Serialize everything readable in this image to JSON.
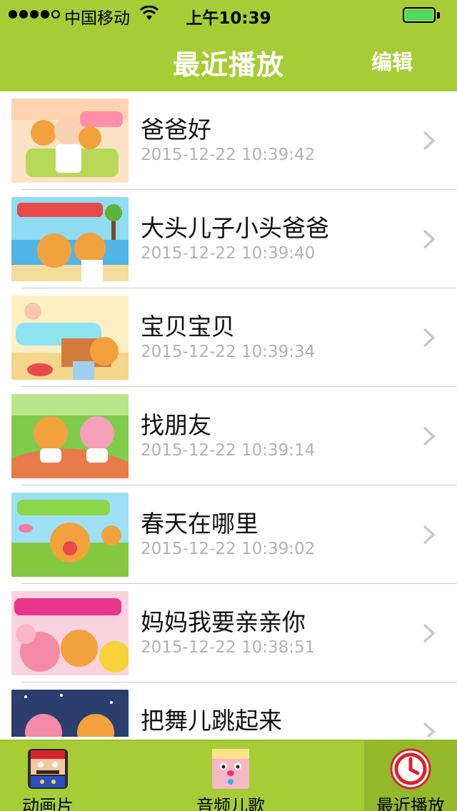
{
  "status_bar": {
    "carrier": "中国移动",
    "time": "上午10:39"
  },
  "nav": {
    "title": "最近播放",
    "edit_label": "编辑"
  },
  "items": [
    {
      "title": "爸爸好",
      "time": "2015-12-22 10:39:42",
      "thumb_label": "爸爸好"
    },
    {
      "title": "大头儿子小头爸爸",
      "time": "2015-12-22 10:39:40",
      "thumb_label": "大头儿子小头爸爸"
    },
    {
      "title": "宝贝宝贝",
      "time": "2015-12-22 10:39:34",
      "thumb_label": "宝贝宝贝"
    },
    {
      "title": "找朋友",
      "time": "2015-12-22 10:39:14",
      "thumb_label": ""
    },
    {
      "title": "春天在哪里",
      "time": "2015-12-22 10:39:02",
      "thumb_label": "春天在哪里"
    },
    {
      "title": "妈妈我要亲亲你",
      "time": "2015-12-22 10:38:51",
      "thumb_label": "妈妈我要亲亲你"
    },
    {
      "title": "把舞儿跳起来",
      "time": "",
      "thumb_label": ""
    }
  ],
  "tabs": [
    {
      "label": "动画片",
      "icon": "cartoon-icon"
    },
    {
      "label": "音频儿歌",
      "icon": "music-box-icon"
    },
    {
      "label": "最近播放",
      "icon": "recent-clock-icon"
    }
  ],
  "colors": {
    "brand_green": "#a6cd35",
    "tab_active": "#93b82a",
    "timestamp_gray": "#b3b3b3"
  }
}
